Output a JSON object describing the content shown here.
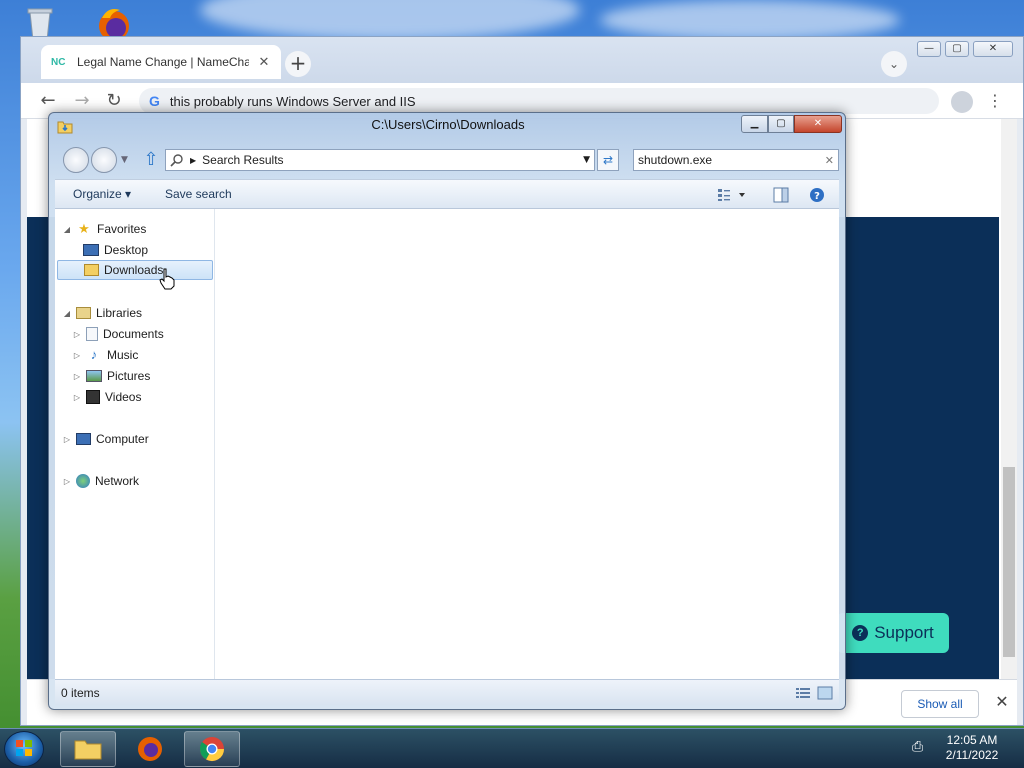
{
  "chrome": {
    "tab": {
      "favicon": "NC",
      "title": "Legal Name Change | NameChar",
      "close_glyph": "✕"
    },
    "new_tab_glyph": "+",
    "tab_menu_glyph": "⌄",
    "window_controls": {
      "minimize": "—",
      "maximize": "▢",
      "close": "✕"
    },
    "nav": {
      "back": "←",
      "forward": "→",
      "reload": "↻"
    },
    "omnibox": {
      "google_glyph": "G",
      "text": "this probably runs Windows Server and IIS"
    },
    "menu_glyph": "⋮",
    "page": {
      "support_label": "Support"
    },
    "downloads": {
      "show_all": "Show all",
      "close_glyph": "✕"
    }
  },
  "explorer": {
    "title": "C:\\Users\\Cirno\\Downloads",
    "controls": {
      "minimize": "▁",
      "maximize": "▢",
      "close": "✕"
    },
    "address": {
      "text": "Search Results"
    },
    "search": {
      "value": "shutdown.exe"
    },
    "commands": {
      "organize": "Organize ▾",
      "save_search": "Save search"
    },
    "nav_pane": {
      "favorites": "Favorites",
      "desktop": "Desktop",
      "downloads": "Downloads",
      "libraries": "Libraries",
      "documents": "Documents",
      "music": "Music",
      "pictures": "Pictures",
      "videos": "Videos",
      "computer": "Computer",
      "network": "Network"
    },
    "status": "0 items"
  },
  "taskbar": {
    "clock_time": "12:05 AM",
    "clock_date": "2/11/2022"
  },
  "icons": [
    "recycle-bin-icon",
    "firefox-icon",
    "folder-icon",
    "chrome-icon",
    "star-icon",
    "desktop-icon",
    "library-icon",
    "documents-icon",
    "music-icon",
    "pictures-icon",
    "videos-icon",
    "computer-icon",
    "network-icon",
    "search-icon",
    "help-icon"
  ]
}
